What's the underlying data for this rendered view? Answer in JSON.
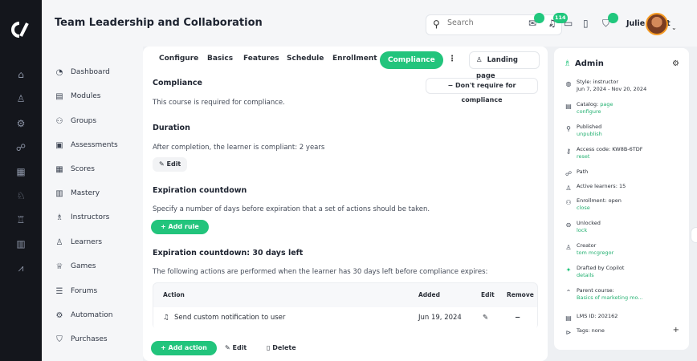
{
  "header": {
    "title": "Team Leadership and Collaboration",
    "search_placeholder": "Search",
    "badges": {
      "messages": "",
      "notifications": "114",
      "cart": ""
    },
    "user_name": "Julie Scott"
  },
  "nav": {
    "items": [
      {
        "label": "Dashboard",
        "icon": "dashboard-icon"
      },
      {
        "label": "Modules",
        "icon": "modules-icon"
      },
      {
        "label": "Groups",
        "icon": "groups-icon"
      },
      {
        "label": "Assessments",
        "icon": "assessments-icon"
      },
      {
        "label": "Scores",
        "icon": "scores-icon"
      },
      {
        "label": "Mastery",
        "icon": "mastery-icon"
      },
      {
        "label": "Instructors",
        "icon": "instructors-icon"
      },
      {
        "label": "Learners",
        "icon": "learners-icon"
      },
      {
        "label": "Games",
        "icon": "games-icon"
      },
      {
        "label": "Forums",
        "icon": "forums-icon"
      },
      {
        "label": "Automation",
        "icon": "automation-icon"
      },
      {
        "label": "Purchases",
        "icon": "purchases-icon"
      }
    ]
  },
  "tabs": [
    "Configure",
    "Basics",
    "Features",
    "Schedule",
    "Enrollment",
    "Compliance"
  ],
  "active_tab": "Compliance",
  "landing_page_label": "Landing page",
  "compliance": {
    "heading": "Compliance",
    "text": "This course is required for compliance.",
    "dont_require_label": "Don't require for compliance"
  },
  "duration": {
    "heading": "Duration",
    "text": "After completion, the learner is compliant: 2 years",
    "edit_label": "Edit"
  },
  "expiration": {
    "heading": "Expiration countdown",
    "text": "Specify a number of days before expiration that a set of actions should be taken.",
    "add_rule_label": "Add rule"
  },
  "countdown": {
    "heading": "Expiration countdown: 30 days left",
    "text": "The following actions are performed when the learner has 30 days left before compliance expires:",
    "columns": [
      "Action",
      "Added",
      "Edit",
      "Remove"
    ],
    "rows": [
      {
        "action": "Send custom notification to user",
        "added": "Jun 19, 2024"
      }
    ],
    "add_action_label": "Add action",
    "edit_label": "Edit",
    "delete_label": "Delete"
  },
  "side": {
    "title": "Admin",
    "rows": [
      {
        "icon": "style-icon",
        "text": "Style: instructor",
        "sub": "Jun 7, 2024 - Nov 20, 2024",
        "link": ""
      },
      {
        "icon": "catalog-icon",
        "text": "Catalog:",
        "sub": "",
        "link": "page",
        "link2": "configure"
      },
      {
        "icon": "published-icon",
        "text": "Published",
        "sub": "",
        "link": "unpublish"
      },
      {
        "icon": "access-code-icon",
        "text": "Access code: KW8B-6TDF",
        "sub": "",
        "link": "reset"
      },
      {
        "icon": "path-icon",
        "text": "Path",
        "sub": "",
        "link": ""
      },
      {
        "icon": "active-learners-icon",
        "text": "Active learners: 15",
        "sub": "",
        "link": ""
      },
      {
        "icon": "enrollment-icon",
        "text": "Enrollment: open",
        "sub": "",
        "link": "close"
      },
      {
        "icon": "lock-icon",
        "text": "Unlocked",
        "sub": "",
        "link": "lock"
      },
      {
        "icon": "creator-icon",
        "text": "Creator",
        "sub": "",
        "link": "tom mcgregor"
      },
      {
        "icon": "copilot-icon",
        "text": "Drafted by Copilot",
        "sub": "",
        "link": "details"
      },
      {
        "icon": "parent-course-icon",
        "text": "Parent course:",
        "sub": "",
        "link": "Basics of marketing mo..."
      },
      {
        "icon": "lms-id-icon",
        "text": "LMS ID: 202162",
        "sub": "",
        "link": ""
      },
      {
        "icon": "tag-icon",
        "text": "Tags: none",
        "sub": "",
        "link": ""
      }
    ]
  },
  "colors": {
    "accent": "#22c47c",
    "rail": "#14161c",
    "background": "#eef0f3"
  }
}
